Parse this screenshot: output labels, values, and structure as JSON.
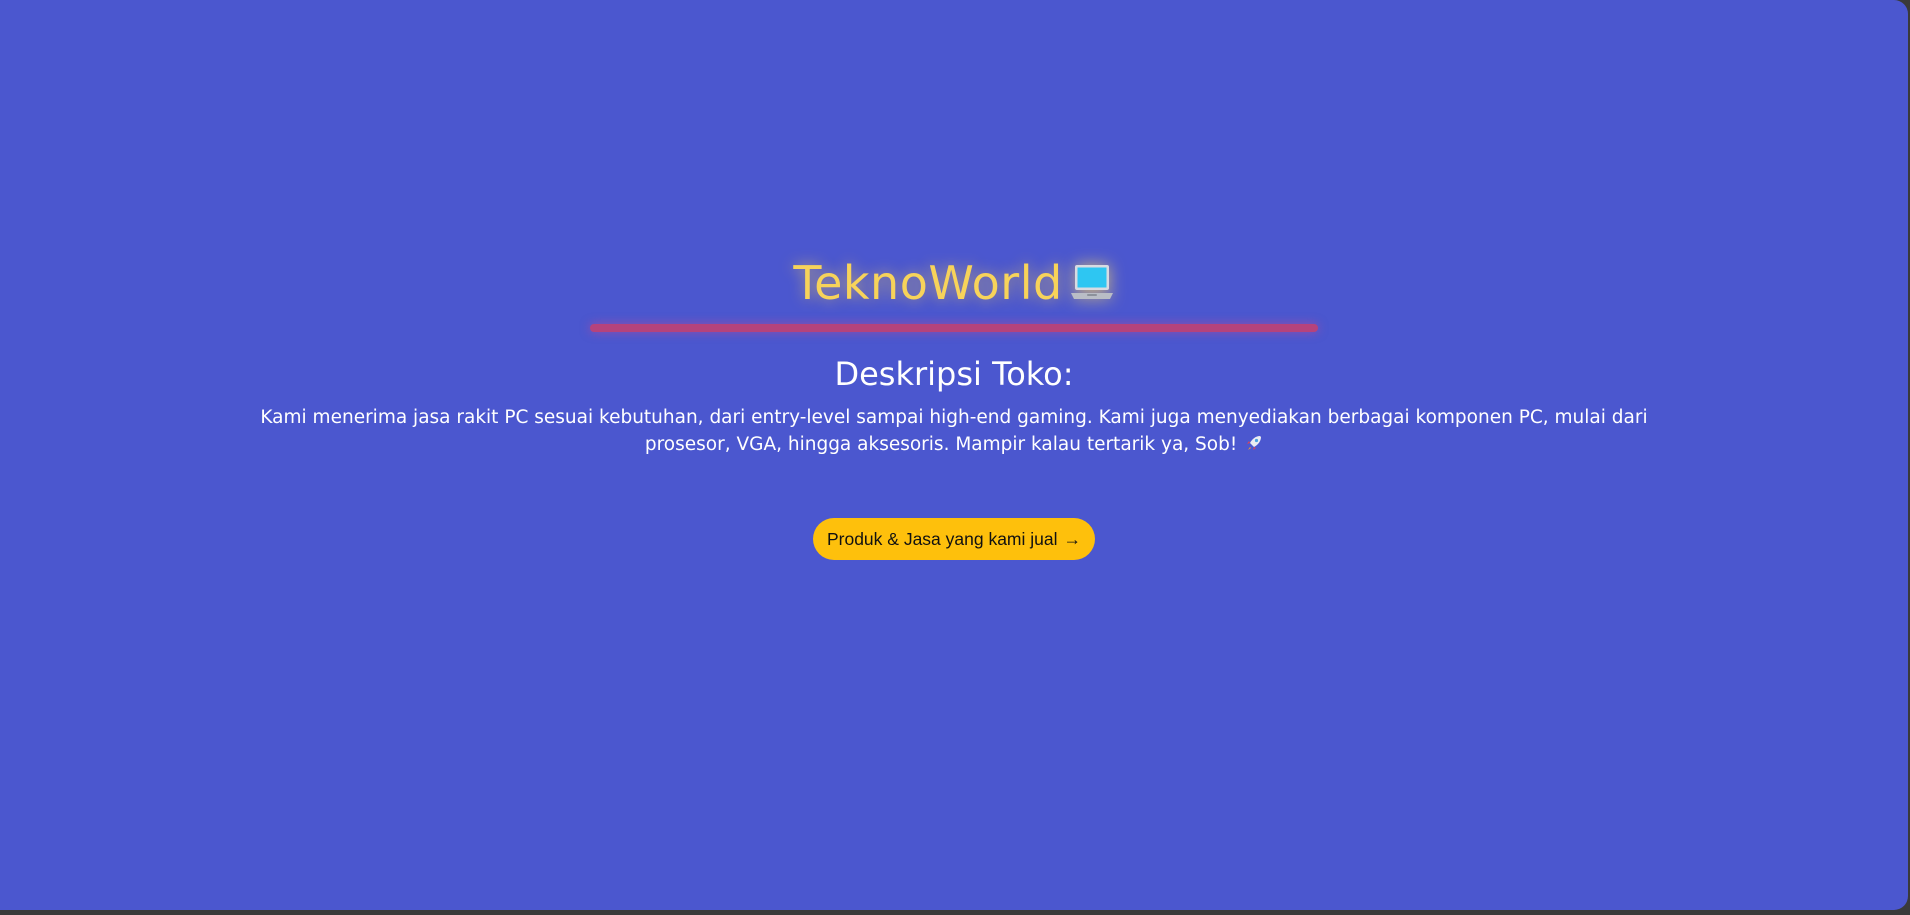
{
  "brand": {
    "title": "TeknoWorld",
    "icon": "laptop-icon",
    "title_color": "#f7d35a",
    "divider_color": "#b6437c"
  },
  "section": {
    "title": "Deskripsi Toko:",
    "description": "Kami menerima jasa rakit PC sesuai kebutuhan, dari entry-level sampai high-end gaming. Kami juga menyediakan berbagai komponen PC, mulai dari prosesor, VGA, hingga aksesoris. Mampir kalau tertarik ya, Sob!",
    "description_icon": "rocket-icon"
  },
  "cta": {
    "label": "Produk & Jasa yang kami jual",
    "arrow": "→",
    "color": "#fec00c"
  },
  "theme": {
    "background": "#4b57cf"
  }
}
